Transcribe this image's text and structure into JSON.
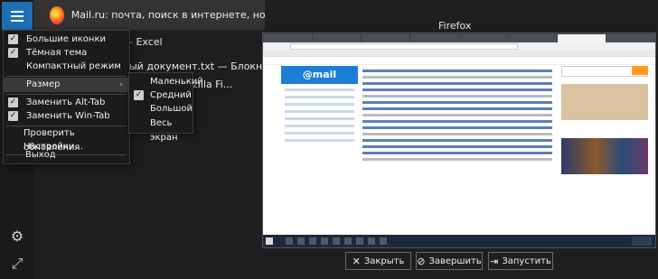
{
  "window_item": {
    "title": "Mail.ru: почта, поиск в интернете, новости, и..."
  },
  "background_texts": {
    "excel": "- Excel",
    "notepad": "ый документ.txt — Блокнот",
    "firefox_partial": "zilla Fi..."
  },
  "menu": {
    "items": [
      {
        "label": "Большие иконки",
        "checked": true
      },
      {
        "label": "Тёмная тема",
        "checked": true
      },
      {
        "label": "Компактный режим",
        "checked": false
      },
      {
        "label": "Размер",
        "checked": false,
        "submenu": true
      },
      {
        "label": "Заменить Alt-Tab",
        "checked": true
      },
      {
        "label": "Заменить Win-Tab",
        "checked": true
      },
      {
        "label": "Проверить обновления",
        "checked": false
      },
      {
        "label": "Настройки...",
        "checked": false
      },
      {
        "label": "Выход",
        "checked": false
      }
    ],
    "submenu_items": [
      {
        "label": "Маленький",
        "checked": false
      },
      {
        "label": "Средний",
        "checked": true
      },
      {
        "label": "Большой",
        "checked": false
      },
      {
        "label": "Весь экран",
        "checked": false
      }
    ]
  },
  "preview": {
    "heading": "Firefox",
    "mail_logo": "@mail"
  },
  "buttons": {
    "close": "Закрыть",
    "terminate": "Завершить",
    "launch": "Запустить"
  },
  "icons": {
    "check": "✓",
    "submenu_arrow": "›",
    "gear": "⚙",
    "fullscreen": "⤢",
    "close": "✕",
    "terminate": "⊘",
    "launch": "⇥"
  }
}
